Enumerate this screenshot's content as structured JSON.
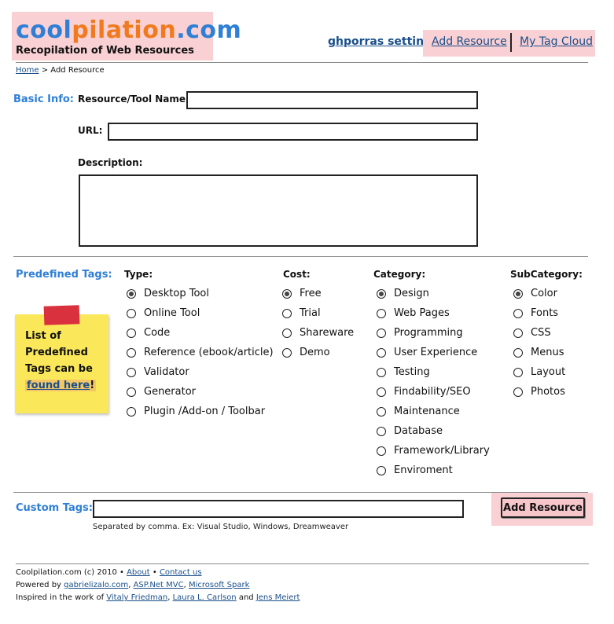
{
  "header": {
    "logo_part1": "cool",
    "logo_part2": "pilation",
    "logo_part3": ".com",
    "tagline": "Recopilation of Web Resources",
    "settings_link": "ghporras settings",
    "add_resource_link": "Add Resource",
    "tag_cloud_link": "My Tag Cloud"
  },
  "breadcrumb": {
    "home": "Home",
    "separator": " > ",
    "current": "Add Resource"
  },
  "basic_info": {
    "section_label": "Basic Info:",
    "name_label": "Resource/Tool Name:",
    "name_value": "",
    "url_label": "URL:",
    "url_value": "",
    "description_label": "Description:",
    "description_value": ""
  },
  "predefined_tags": {
    "section_label": "Predefined Tags:",
    "columns": [
      {
        "title": "Type:",
        "options": [
          {
            "label": "Desktop Tool",
            "selected": true
          },
          {
            "label": "Online Tool",
            "selected": false
          },
          {
            "label": "Code",
            "selected": false
          },
          {
            "label": "Reference (ebook/article)",
            "selected": false
          },
          {
            "label": "Validator",
            "selected": false
          },
          {
            "label": "Generator",
            "selected": false
          },
          {
            "label": "Plugin /Add-on / Toolbar",
            "selected": false
          }
        ]
      },
      {
        "title": "Cost:",
        "options": [
          {
            "label": "Free",
            "selected": true
          },
          {
            "label": "Trial",
            "selected": false
          },
          {
            "label": "Shareware",
            "selected": false
          },
          {
            "label": "Demo",
            "selected": false
          }
        ]
      },
      {
        "title": "Category:",
        "options": [
          {
            "label": "Design",
            "selected": true
          },
          {
            "label": "Web Pages",
            "selected": false
          },
          {
            "label": "Programming",
            "selected": false
          },
          {
            "label": "User Experience",
            "selected": false
          },
          {
            "label": "Testing",
            "selected": false
          },
          {
            "label": "Findability/SEO",
            "selected": false
          },
          {
            "label": "Maintenance",
            "selected": false
          },
          {
            "label": "Database",
            "selected": false
          },
          {
            "label": "Framework/Library",
            "selected": false
          },
          {
            "label": "Enviroment",
            "selected": false
          }
        ]
      },
      {
        "title": "SubCategory:",
        "options": [
          {
            "label": "Color",
            "selected": true
          },
          {
            "label": "Fonts",
            "selected": false
          },
          {
            "label": "CSS",
            "selected": false
          },
          {
            "label": "Menus",
            "selected": false
          },
          {
            "label": "Layout",
            "selected": false
          },
          {
            "label": "Photos",
            "selected": false
          }
        ]
      }
    ],
    "sticky_note": {
      "text": "List of Predefined Tags can be",
      "link": "found here",
      "suffix": "!"
    }
  },
  "custom_tags": {
    "section_label": "Custom Tags:",
    "value": "",
    "hint": "Separated by comma. Ex: Visual Studio, Windows, Dreamweaver",
    "submit_label": "Add Resource"
  },
  "footer": {
    "copyright": "Coolpilation.com (c) 2010",
    "bullet": " • ",
    "about": "About",
    "contact": "Contact us",
    "powered_prefix": "Powered by ",
    "powered_links": [
      "gabrielizalo.com",
      "ASP.Net MVC",
      "Microsoft Spark"
    ],
    "inspired_prefix": "Inspired in the work of ",
    "inspired_links": [
      "Vitaly Friedman",
      "Laura L. Carlson",
      "Jens Meiert"
    ],
    "inspired_and": " and "
  },
  "colors": {
    "accent_blue": "#2f7fd6",
    "accent_orange": "#f07a1d",
    "highlight_pink": "#f9d0d3",
    "sticky_yellow": "#fbe85a",
    "tape_red": "#d9323e"
  }
}
